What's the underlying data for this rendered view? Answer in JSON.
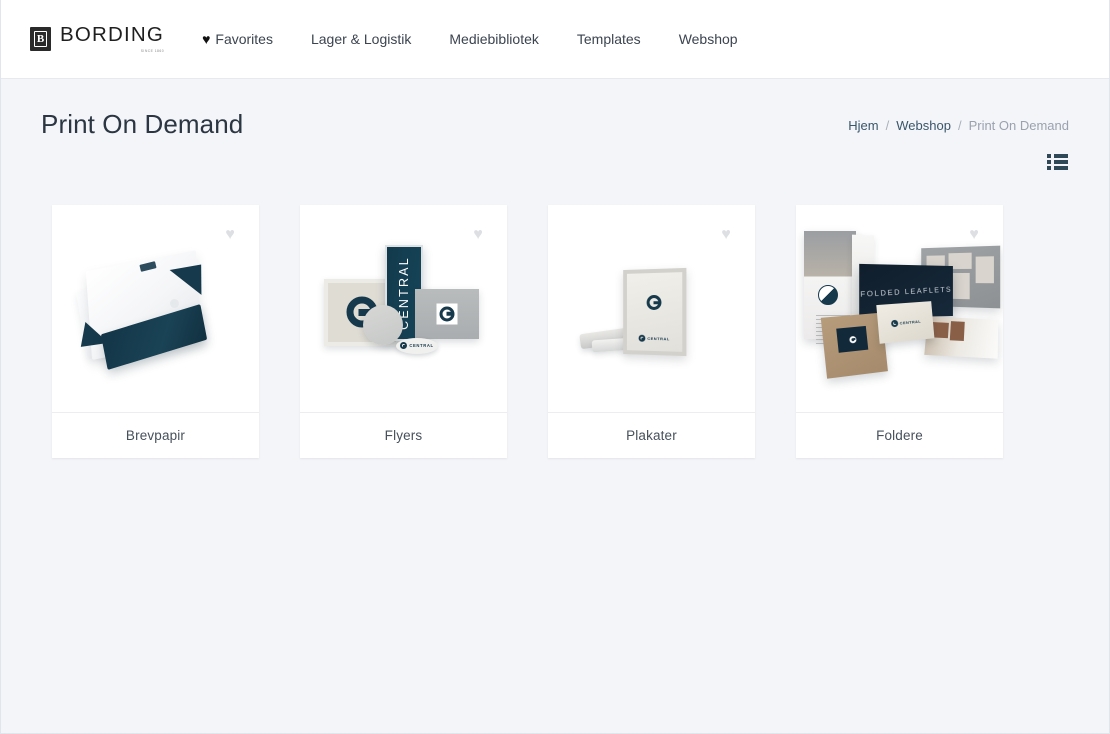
{
  "header": {
    "brand": {
      "mark_letter": "B",
      "name": "BORDING",
      "subtitle": "SINCE 1860"
    },
    "nav": [
      {
        "label": "Favorites",
        "icon": "heart-icon"
      },
      {
        "label": "Lager & Logistik",
        "icon": ""
      },
      {
        "label": "Mediebibliotek",
        "icon": ""
      },
      {
        "label": "Templates",
        "icon": ""
      },
      {
        "label": "Webshop",
        "icon": ""
      }
    ]
  },
  "page": {
    "title": "Print On Demand",
    "breadcrumb": [
      {
        "label": "Hjem",
        "current": false
      },
      {
        "label": "Webshop",
        "current": false
      },
      {
        "label": "Print On Demand",
        "current": true
      }
    ],
    "breadcrumb_separator": "/"
  },
  "toolbar": {
    "view_toggle_icon": "list-view-icon"
  },
  "products": [
    {
      "name": "Brevpapir",
      "favorite_icon": "heart-icon",
      "favorited": false,
      "image_alt": "letterhead-and-envelope"
    },
    {
      "name": "Flyers",
      "favorite_icon": "heart-icon",
      "favorited": false,
      "image_alt": "central-branded-flyers",
      "artwork_text": "CENTRAL"
    },
    {
      "name": "Plakater",
      "favorite_icon": "heart-icon",
      "favorited": false,
      "image_alt": "poster-with-logo",
      "artwork_text": "CENTRAL"
    },
    {
      "name": "Foldere",
      "favorite_icon": "heart-icon",
      "favorited": false,
      "image_alt": "folded-leaflets",
      "artwork_text": "FOLDED LEAFLETS"
    }
  ],
  "colors": {
    "page_background": "#f4f5f9",
    "header_background": "#ffffff",
    "card_background": "#ffffff",
    "text_primary": "#2b3642",
    "link": "#39566b",
    "muted": "#9aa2ae",
    "brand_dark_teal": "#16394b",
    "heart_inactive": "#dddfe3"
  }
}
